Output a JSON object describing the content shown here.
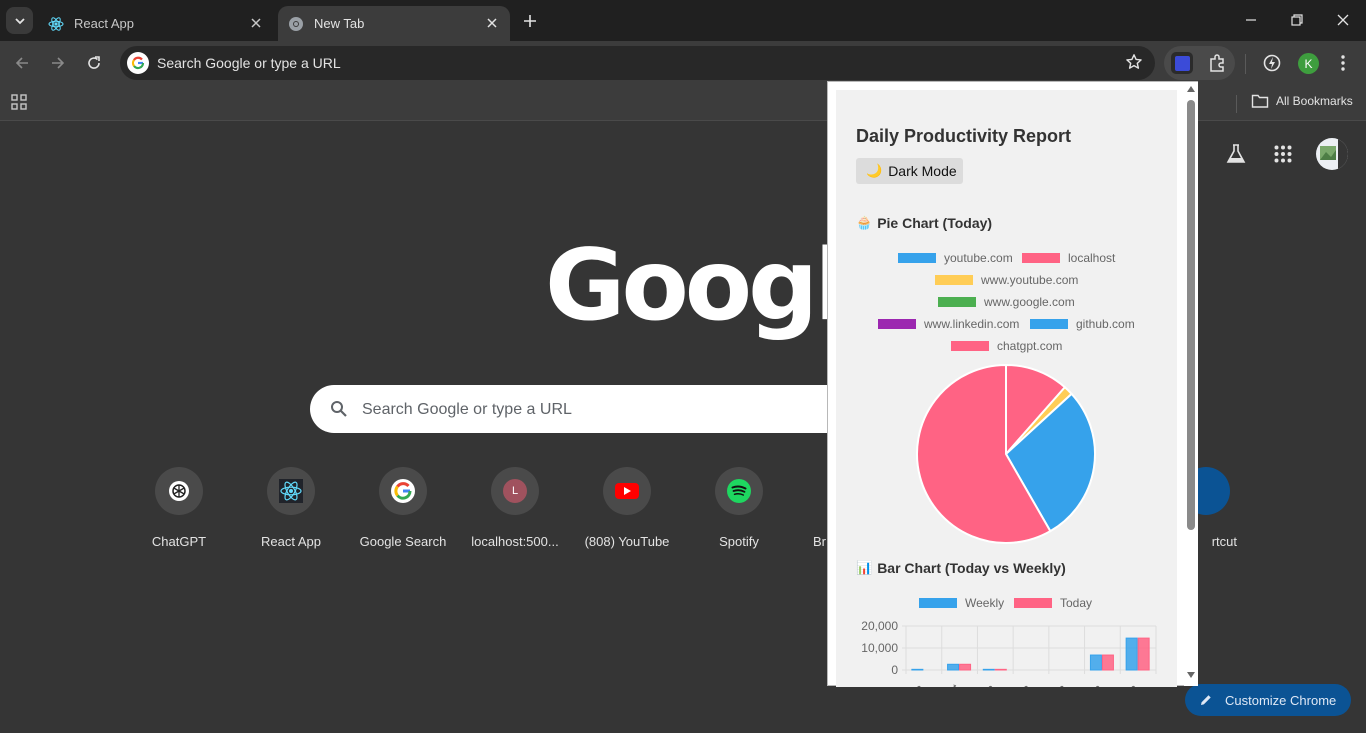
{
  "tabs": [
    {
      "title": "React App",
      "active": false
    },
    {
      "title": "New Tab",
      "active": true
    }
  ],
  "omnibox": {
    "placeholder": "Search Google or type a URL"
  },
  "profile_initial": "K",
  "bookmarks": {
    "all_bookmarks": "All Bookmarks"
  },
  "ntp": {
    "logo": "Google",
    "search_placeholder": "Search Google or type a URL",
    "shortcuts": [
      {
        "label": "ChatGPT",
        "icon": "chatgpt-icon"
      },
      {
        "label": "React App",
        "icon": "react-icon"
      },
      {
        "label": "Google Search",
        "icon": "google-icon"
      },
      {
        "label": "localhost:500...",
        "icon": "letter-l-icon",
        "letter": "L"
      },
      {
        "label": "(808) YouTube",
        "icon": "youtube-icon"
      },
      {
        "label": "Spotify",
        "icon": "spotify-icon"
      },
      {
        "label": "Br",
        "icon": "partial-icon"
      },
      {
        "label": "rtcut",
        "icon": "add-shortcut-icon"
      }
    ],
    "customize_label": "Customize Chrome"
  },
  "popup": {
    "title": "Daily Productivity Report",
    "dark_mode_label": "Dark Mode",
    "dark_mode_icon": "🌙",
    "pie_section_title": "Pie Chart (Today)",
    "pie_section_icon": "🧁",
    "bar_section_title": "Bar Chart (Today vs Weekly)",
    "bar_section_icon": "📊"
  },
  "colors": {
    "blue": "#36a2eb",
    "pink": "#ff6384",
    "yellow": "#ffcd56",
    "green": "#4caf50",
    "purple": "#9c27b0"
  },
  "chart_data": [
    {
      "type": "pie",
      "title": "Pie Chart (Today)",
      "legend_position": "top",
      "labels": [
        "youtube.com",
        "localhost",
        "www.youtube.com",
        "www.google.com",
        "www.linkedin.com",
        "github.com",
        "chatgpt.com"
      ],
      "colors": [
        "#36a2eb",
        "#ff6384",
        "#ffcd56",
        "#4caf50",
        "#9c27b0",
        "#36a2eb",
        "#ff6384"
      ],
      "values": [
        0,
        11.5,
        1.7,
        0,
        0,
        28.5,
        58.3
      ]
    },
    {
      "type": "bar",
      "title": "Bar Chart (Today vs Weekly)",
      "legend_position": "top",
      "categories": [
        "youtube.com",
        "localhost",
        "www.youtube.com",
        "www.google.com",
        "www.linkedin.com",
        "github.com",
        "chatgpt.com"
      ],
      "tick_labels": [
        "om",
        "ost",
        "om",
        "om",
        "om",
        "om",
        "om"
      ],
      "series": [
        {
          "name": "Weekly",
          "color": "#36a2eb",
          "values": [
            300,
            2600,
            300,
            0,
            0,
            6800,
            14500
          ]
        },
        {
          "name": "Today",
          "color": "#ff6384",
          "values": [
            0,
            2600,
            300,
            0,
            0,
            6800,
            14500
          ]
        }
      ],
      "y_ticks": [
        "20,000",
        "10,000",
        "0"
      ],
      "ylim": [
        0,
        20000
      ]
    }
  ]
}
